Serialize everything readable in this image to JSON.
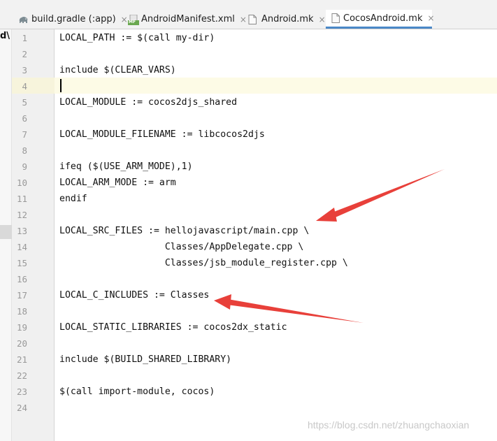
{
  "tabs": [
    {
      "label": "build.gradle (:app)",
      "icon": "gradle-elephant-icon",
      "active": false
    },
    {
      "label": "AndroidManifest.xml",
      "icon": "manifest-file-icon",
      "icon_text": "MF",
      "active": false
    },
    {
      "label": "Android.mk",
      "icon": "file-icon",
      "active": false
    },
    {
      "label": "CocosAndroid.mk",
      "icon": "file-icon",
      "active": true
    }
  ],
  "tab_close_glyph": "×",
  "structure_label": "d\\",
  "editor": {
    "current_line": 4,
    "lines": [
      {
        "num": "1",
        "text": "LOCAL_PATH := $(call my-dir)"
      },
      {
        "num": "2",
        "text": ""
      },
      {
        "num": "3",
        "text": "include $(CLEAR_VARS)"
      },
      {
        "num": "4",
        "text": ""
      },
      {
        "num": "5",
        "text": "LOCAL_MODULE := cocos2djs_shared"
      },
      {
        "num": "6",
        "text": ""
      },
      {
        "num": "7",
        "text": "LOCAL_MODULE_FILENAME := libcocos2djs"
      },
      {
        "num": "8",
        "text": ""
      },
      {
        "num": "9",
        "text": "ifeq ($(USE_ARM_MODE),1)"
      },
      {
        "num": "10",
        "text": "LOCAL_ARM_MODE := arm"
      },
      {
        "num": "11",
        "text": "endif"
      },
      {
        "num": "12",
        "text": ""
      },
      {
        "num": "13",
        "text": "LOCAL_SRC_FILES := hellojavascript/main.cpp \\"
      },
      {
        "num": "14",
        "text": "                   Classes/AppDelegate.cpp \\"
      },
      {
        "num": "15",
        "text": "                   Classes/jsb_module_register.cpp \\"
      },
      {
        "num": "16",
        "text": ""
      },
      {
        "num": "17",
        "text": "LOCAL_C_INCLUDES := Classes"
      },
      {
        "num": "18",
        "text": ""
      },
      {
        "num": "19",
        "text": "LOCAL_STATIC_LIBRARIES := cocos2dx_static"
      },
      {
        "num": "20",
        "text": ""
      },
      {
        "num": "21",
        "text": "include $(BUILD_SHARED_LIBRARY)"
      },
      {
        "num": "22",
        "text": ""
      },
      {
        "num": "23",
        "text": "$(call import-module, cocos)"
      },
      {
        "num": "24",
        "text": ""
      }
    ]
  },
  "annotations": {
    "arrow_color": "#e8403a",
    "arrows": [
      "arrow-to-local-src-files",
      "arrow-to-local-c-includes"
    ]
  },
  "watermark": "https://blog.csdn.net/zhuangchaoxian",
  "colors": {
    "active_tab_underline": "#4a88c7",
    "current_line_highlight": "#fdfbe6",
    "gutter_bg": "#f0f0f0",
    "line_number": "#999999"
  }
}
